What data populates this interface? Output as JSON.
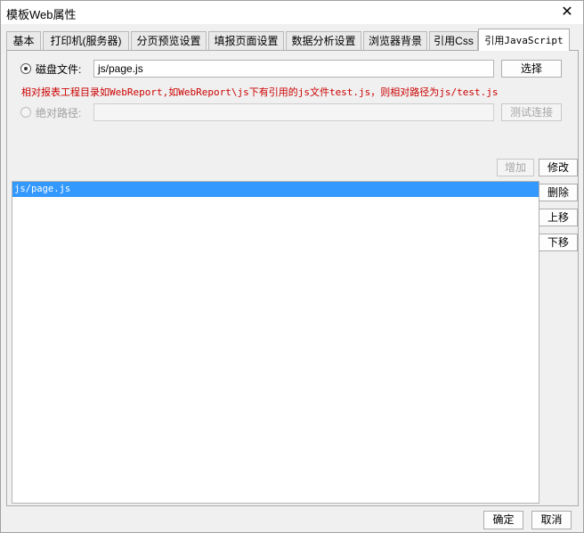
{
  "window": {
    "title": "模板Web属性",
    "close_glyph": "✕"
  },
  "tabs": [
    {
      "label": "基本"
    },
    {
      "label": "打印机(服务器)"
    },
    {
      "label": "分页预览设置"
    },
    {
      "label": "填报页面设置"
    },
    {
      "label": "数据分析设置"
    },
    {
      "label": "浏览器背景"
    },
    {
      "label": "引用Css"
    },
    {
      "label": "引用JavaScript",
      "active": true
    }
  ],
  "disk_file": {
    "label": "磁盘文件:",
    "value": "js/page.js",
    "button": "选择",
    "selected": true
  },
  "hint": "相对报表工程目录如WebReport,如WebReport\\js下有引用的js文件test.js，则相对路径为js/test.js",
  "absolute_path": {
    "label": "绝对路径:",
    "value": "",
    "button": "测试连接",
    "enabled": false
  },
  "list_buttons": {
    "add": "增加",
    "modify": "修改",
    "delete": "删除",
    "move_up": "上移",
    "move_down": "下移"
  },
  "file_list": [
    {
      "path": "js/page.js",
      "selected": true
    }
  ],
  "footer": {
    "ok": "确定",
    "cancel": "取消"
  }
}
